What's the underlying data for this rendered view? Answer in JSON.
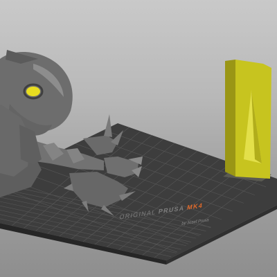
{
  "viewport": {
    "bed": {
      "brand_prefix": "ORIGINAL",
      "brand_name": "PRUSA",
      "model": "MK4",
      "byline": "by Josef Prusa"
    },
    "objects": [
      {
        "name": "creature-model",
        "color": "#6e6e6e"
      },
      {
        "name": "wipe-tower",
        "color": "#c7c41f"
      }
    ],
    "colors": {
      "background_top": "#c9c9c9",
      "background_bottom": "#8e8e8e",
      "bed_surface": "#3d3d3d",
      "bed_edge": "#2b2b2b",
      "grid_line": "#585858",
      "model_body": "#6e6e6e",
      "model_highlight": "#8d8d8d",
      "model_eye": "#e8dd20",
      "wipe_tower_light": "#d4d12a",
      "wipe_tower_dark": "#9a9615",
      "brand_accent": "#e16a2b"
    }
  }
}
